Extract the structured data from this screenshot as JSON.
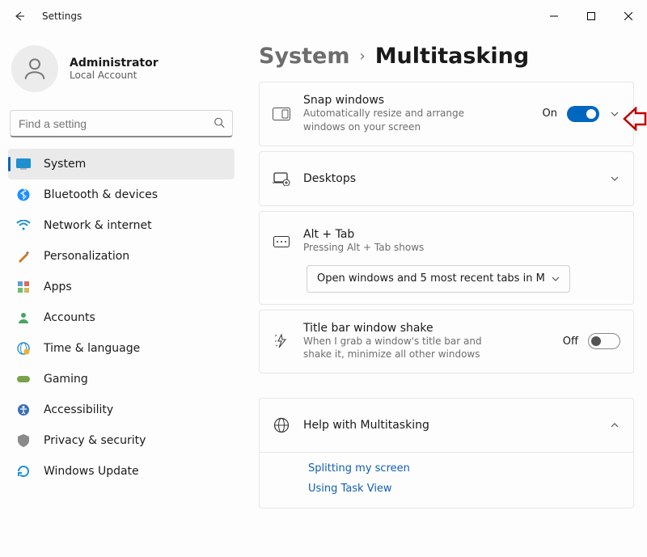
{
  "window": {
    "title": "Settings"
  },
  "profile": {
    "name": "Administrator",
    "sub": "Local Account"
  },
  "search": {
    "placeholder": "Find a setting"
  },
  "nav": {
    "items": [
      {
        "label": "System"
      },
      {
        "label": "Bluetooth & devices"
      },
      {
        "label": "Network & internet"
      },
      {
        "label": "Personalization"
      },
      {
        "label": "Apps"
      },
      {
        "label": "Accounts"
      },
      {
        "label": "Time & language"
      },
      {
        "label": "Gaming"
      },
      {
        "label": "Accessibility"
      },
      {
        "label": "Privacy & security"
      },
      {
        "label": "Windows Update"
      }
    ]
  },
  "breadcrumb": {
    "root": "System",
    "leaf": "Multitasking"
  },
  "cards": {
    "snap": {
      "title": "Snap windows",
      "sub": "Automatically resize and arrange windows on your screen",
      "state": "On"
    },
    "desktops": {
      "title": "Desktops"
    },
    "alttab": {
      "title": "Alt + Tab",
      "sub": "Pressing Alt + Tab shows",
      "select": "Open windows and 5 most recent tabs in M"
    },
    "shake": {
      "title": "Title bar window shake",
      "sub": "When I grab a window's title bar and shake it, minimize all other windows",
      "state": "Off"
    },
    "help": {
      "title": "Help with Multitasking",
      "links": [
        "Splitting my screen",
        "Using Task View"
      ]
    }
  }
}
